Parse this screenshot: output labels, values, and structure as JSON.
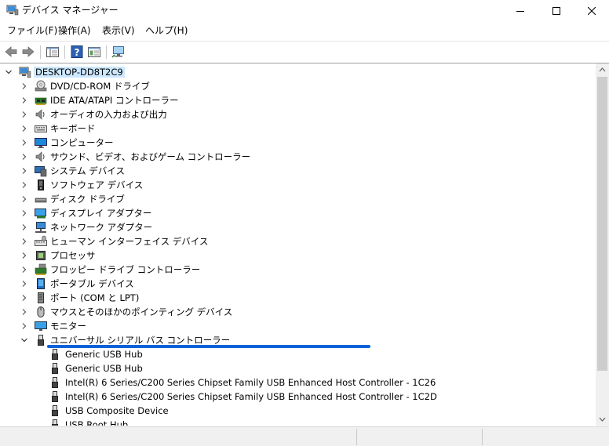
{
  "window": {
    "title": "デバイス マネージャー"
  },
  "menu": [
    "ファイル(F)",
    "操作(A)",
    "表示(V)",
    "ヘルプ(H)"
  ],
  "toolbar": {
    "buttons": [
      "back-arrow",
      "forward-arrow",
      "properties-view",
      "help",
      "update-driver",
      "scan-hardware"
    ]
  },
  "tree": {
    "root": {
      "label": "DESKTOP-DD8T2C9",
      "expanded": true
    },
    "categories": [
      {
        "label": "DVD/CD-ROM ドライブ",
        "icon": "dvd-drive-icon"
      },
      {
        "label": "IDE ATA/ATAPI コントローラー",
        "icon": "ide-controller-icon"
      },
      {
        "label": "オーディオの入力および出力",
        "icon": "speaker-icon"
      },
      {
        "label": "キーボード",
        "icon": "keyboard-icon"
      },
      {
        "label": "コンピューター",
        "icon": "computer-icon"
      },
      {
        "label": "サウンド、ビデオ、およびゲーム コントローラー",
        "icon": "speaker-icon"
      },
      {
        "label": "システム デバイス",
        "icon": "system-device-icon"
      },
      {
        "label": "ソフトウェア デバイス",
        "icon": "software-device-icon"
      },
      {
        "label": "ディスク ドライブ",
        "icon": "disk-drive-icon"
      },
      {
        "label": "ディスプレイ アダプター",
        "icon": "display-adapter-icon"
      },
      {
        "label": "ネットワーク アダプター",
        "icon": "network-adapter-icon"
      },
      {
        "label": "ヒューマン インターフェイス デバイス",
        "icon": "hid-icon"
      },
      {
        "label": "プロセッサ",
        "icon": "processor-icon"
      },
      {
        "label": "フロッピー ドライブ コントローラー",
        "icon": "floppy-controller-icon"
      },
      {
        "label": "ポータブル デバイス",
        "icon": "portable-device-icon"
      },
      {
        "label": "ポート (COM と LPT)",
        "icon": "port-icon"
      },
      {
        "label": "マウスとそのほかのポインティング デバイス",
        "icon": "mouse-icon"
      },
      {
        "label": "モニター",
        "icon": "monitor-icon"
      },
      {
        "label": "ユニバーサル シリアル バス コントローラー",
        "icon": "usb-icon",
        "expanded": true
      }
    ],
    "usb_children": [
      "Generic USB Hub",
      "Generic USB Hub",
      "Intel(R) 6 Series/C200 Series Chipset Family USB Enhanced Host Controller - 1C26",
      "Intel(R) 6 Series/C200 Series Chipset Family USB Enhanced Host Controller - 1C2D",
      "USB Composite Device",
      "USB Root Hub"
    ]
  },
  "colors": {
    "root_highlight": "#cce8ff",
    "annotation_underline": "#0a62d9",
    "icon_blue": "#1e88d8"
  }
}
